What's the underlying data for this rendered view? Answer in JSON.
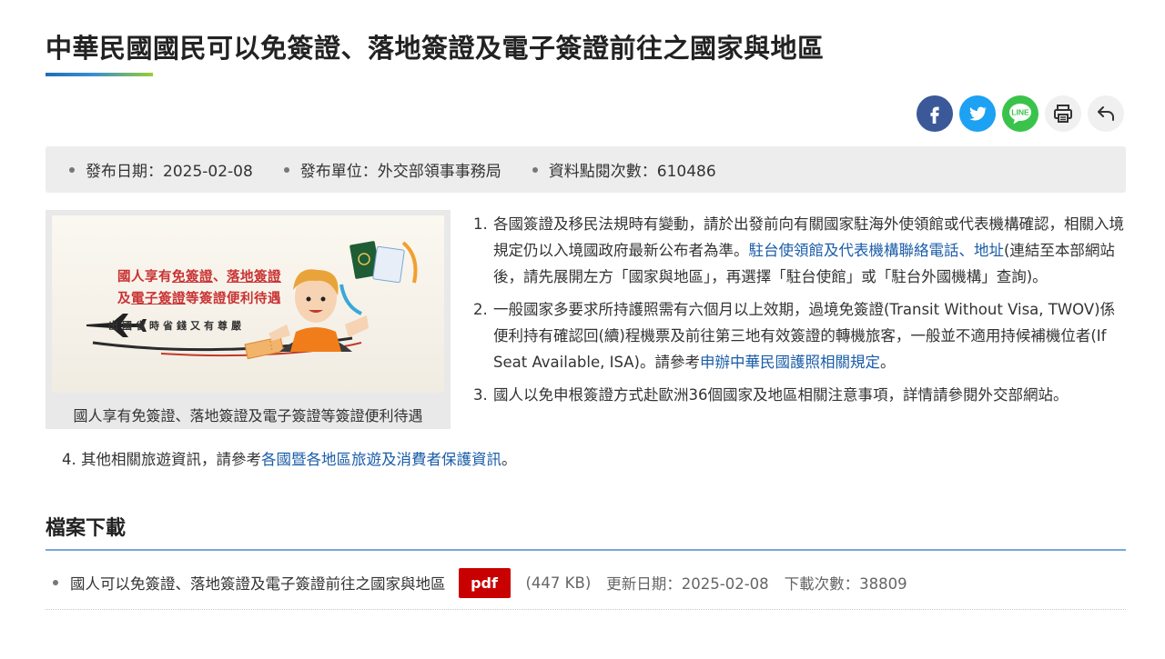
{
  "title": "中華民國國民可以免簽證、落地簽證及電子簽證前往之國家與地區",
  "share": {
    "facebook": "facebook-icon",
    "twitter": "twitter-icon",
    "line": "LINE",
    "print": "printer-icon",
    "back": "back-arrow-icon"
  },
  "meta": {
    "published": "發布日期：2025-02-08",
    "unit": "發布單位：外交部領事事務局",
    "views": "資料點閱次數：610486"
  },
  "figure": {
    "banner_line1_parts": [
      "國人享有",
      "免簽證",
      "、",
      "落地簽證"
    ],
    "banner_line2_parts": [
      "及",
      "電子簽證",
      "等簽證便利待遇"
    ],
    "banner_line3": "出國省時省錢又有尊嚴",
    "caption": "國人享有免簽證、落地簽證及電子簽證等簽證便利待遇"
  },
  "notes": [
    {
      "num": "1.",
      "before": "各國簽證及移民法規時有變動，請於出發前向有關國家駐海外使領館或代表機構確認，相關入境規定仍以入境國政府最新公布者為準。",
      "link": "駐台使領館及代表機構聯絡電話、地址",
      "after": "(連結至本部網站後，請先展開左方「國家與地區」，再選擇「駐台使館」或「駐台外國機構」查詢)。"
    },
    {
      "num": "2.",
      "before": "一般國家多要求所持護照需有六個月以上效期，過境免簽證(Transit Without Visa, TWOV)係便利持有確認回(續)程機票及前往第三地有效簽證的轉機旅客，一般並不適用持候補機位者(If Seat Available, ISA)。請參考",
      "link": "申辦中華民國護照相關規定",
      "after": "。"
    },
    {
      "num": "3.",
      "before": "國人以免申根簽證方式赴歐洲36個國家及地區相關注意事項，詳情請參閱外交部網站。",
      "link": "",
      "after": ""
    }
  ],
  "note4": {
    "num": "4.",
    "before": "其他相關旅遊資訊，請參考",
    "link": "各國暨各地區旅遊及消費者保護資訊",
    "after": "。"
  },
  "download": {
    "heading": "檔案下載",
    "file_name": "國人可以免簽證、落地簽證及電子簽證前往之國家與地區",
    "format": "pdf",
    "size": "(447 KB)",
    "updated": "更新日期：2025-02-08",
    "downloads": "下載次數：38809"
  }
}
